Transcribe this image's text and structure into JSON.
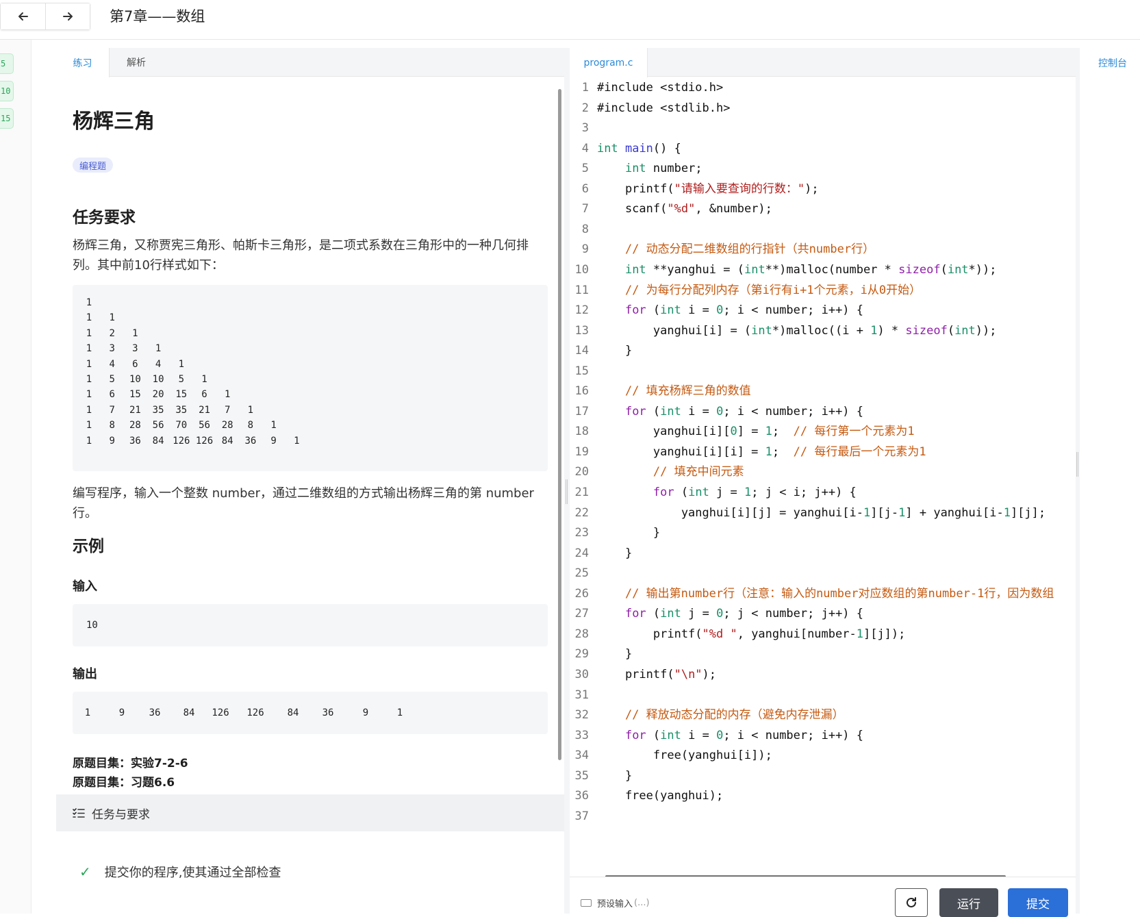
{
  "header": {
    "back_icon": "arrow-left-icon",
    "forward_icon": "arrow-right-icon",
    "chapter_title": "第7章——数组"
  },
  "left_strip": {
    "badges": [
      "5",
      "10",
      "15"
    ],
    "accent": "#2aa55a"
  },
  "problem": {
    "tabs": [
      {
        "label": "练习",
        "active": true
      },
      {
        "label": "解析",
        "active": false
      }
    ],
    "title": "杨辉三角",
    "tag": "编程题",
    "task_heading": "任务要求",
    "description_1": "杨辉三角，又称贾宪三角形、帕斯卡三角形，是二项式系数在三角形中的一种几何排列。其中前10行样式如下：",
    "triangle_rows": [
      [
        "1"
      ],
      [
        "1",
        "1"
      ],
      [
        "1",
        "2",
        "1"
      ],
      [
        "1",
        "3",
        "3",
        "1"
      ],
      [
        "1",
        "4",
        "6",
        "4",
        "1"
      ],
      [
        "1",
        "5",
        "10",
        "10",
        "5",
        "1"
      ],
      [
        "1",
        "6",
        "15",
        "20",
        "15",
        "6",
        "1"
      ],
      [
        "1",
        "7",
        "21",
        "35",
        "35",
        "21",
        "7",
        "1"
      ],
      [
        "1",
        "8",
        "28",
        "56",
        "70",
        "56",
        "28",
        "8",
        "1"
      ],
      [
        "1",
        "9",
        "36",
        "84",
        "126",
        "126",
        "84",
        "36",
        "9",
        "1"
      ]
    ],
    "description_2": "编写程序，输入一个整数 number，通过二维数组的方式输出杨辉三角的第 number 行。",
    "example_heading": "示例",
    "input_heading": "输入",
    "input_value": "10",
    "output_heading": "输出",
    "output_values": [
      "1",
      "9",
      "36",
      "84",
      "126",
      "126",
      "84",
      "36",
      "9",
      "1"
    ],
    "source_1": "原题目集：实验7-2-6",
    "source_2": "原题目集：习题6.6",
    "task_bar_label": "任务与要求",
    "check_item": "提交你的程序,使其通过全部检查"
  },
  "editor": {
    "file_tab": "program.c",
    "code_lines": [
      "#include <stdio.h>",
      "#include <stdlib.h>",
      "",
      "int main() {",
      "    int number;",
      "    printf(\"请输入要查询的行数：\");",
      "    scanf(\"%d\", &number);",
      "",
      "    // 动态分配二维数组的行指针（共number行）",
      "    int **yanghui = (int**)malloc(number * sizeof(int*));",
      "    // 为每行分配列内存（第i行有i+1个元素，i从0开始）",
      "    for (int i = 0; i < number; i++) {",
      "        yanghui[i] = (int*)malloc((i + 1) * sizeof(int));",
      "    }",
      "",
      "    // 填充杨辉三角的数值",
      "    for (int i = 0; i < number; i++) {",
      "        yanghui[i][0] = 1;  // 每行第一个元素为1",
      "        yanghui[i][i] = 1;  // 每行最后一个元素为1",
      "        // 填充中间元素",
      "        for (int j = 1; j < i; j++) {",
      "            yanghui[i][j] = yanghui[i-1][j-1] + yanghui[i-1][j];",
      "        }",
      "    }",
      "",
      "    // 输出第number行（注意：输入的number对应数组的第number-1行，因为数组",
      "    for (int j = 0; j < number; j++) {",
      "        printf(\"%d \", yanghui[number-1][j]);",
      "    }",
      "    printf(\"\\n\");",
      "",
      "    // 释放动态分配的内存（避免内存泄漏）",
      "    for (int i = 0; i < number; i++) {",
      "        free(yanghui[i]);",
      "    }",
      "    free(yanghui);",
      ""
    ],
    "preset_label": "预设输入",
    "preset_hint": "(...)",
    "reset_icon": "refresh-icon",
    "run_label": "运行",
    "submit_label": "提交",
    "submit_color": "#2b6fd8"
  },
  "console": {
    "label": "控制台"
  }
}
